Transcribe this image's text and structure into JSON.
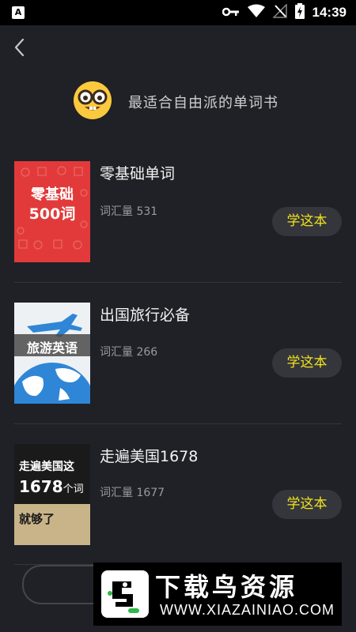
{
  "status_bar": {
    "time": "14:39",
    "app_icon": "A",
    "icons": [
      "key-icon",
      "wifi-icon",
      "signal-off-icon",
      "battery-charging-icon"
    ]
  },
  "header": {
    "title": "最适合自由派的单词书",
    "emoji": "nerd-face-icon"
  },
  "books": [
    {
      "title": "零基础单词",
      "count_label": "词汇量 531",
      "button": "学这本",
      "cover": {
        "line1": "零基础",
        "line2": "500词",
        "color": "#e23a3a"
      }
    },
    {
      "title": "出国旅行必备",
      "count_label": "词汇量 266",
      "button": "学这本",
      "cover": {
        "line1": "旅游英语",
        "color": "#2f86d6"
      }
    },
    {
      "title": "走遍美国1678",
      "count_label": "词汇量 1677",
      "button": "学这本",
      "cover": {
        "line1": "走遍美国这",
        "line2a": "1678",
        "line2b": "个词",
        "line3": "就够了",
        "color": "#1a1a1a"
      }
    }
  ],
  "watermark": {
    "title": "下载鸟资源",
    "url": "WWW.XIAZAINIAO.COM"
  },
  "colors": {
    "background": "#1f2127",
    "button_bg": "#34363c",
    "button_text": "#f2e21d"
  }
}
